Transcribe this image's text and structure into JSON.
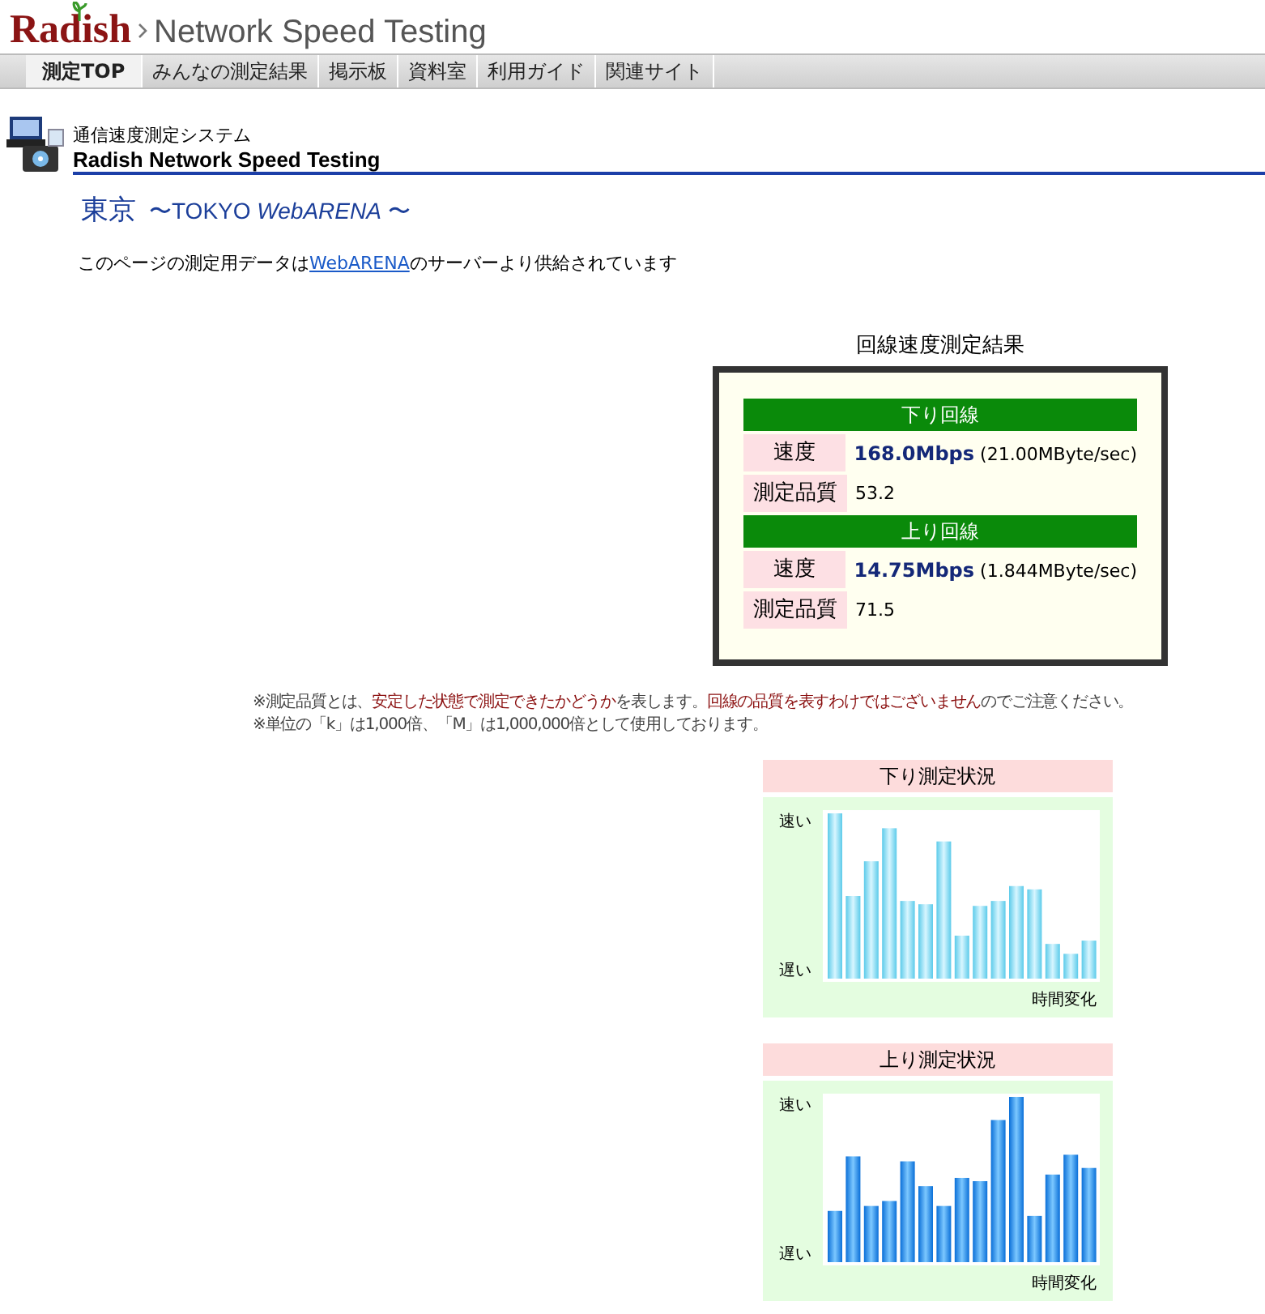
{
  "header": {
    "logo": "Radish",
    "title": "Network Speed Testing"
  },
  "nav": {
    "tabs": [
      {
        "label": "測定TOP",
        "selected": true
      },
      {
        "label": "みんなの測定結果",
        "selected": false
      },
      {
        "label": "掲示板",
        "selected": false
      },
      {
        "label": "資料室",
        "selected": false
      },
      {
        "label": "利用ガイド",
        "selected": false
      },
      {
        "label": "関連サイト",
        "selected": false
      }
    ]
  },
  "system": {
    "subtitle": "通信速度測定システム",
    "title": "Radish Network Speed Testing"
  },
  "location": {
    "city": "東京",
    "detail": "〜TOKYO *WebARENA* 〜"
  },
  "source_note": {
    "before": "このページの測定用データは",
    "link": "WebARENA",
    "after": "のサーバーより供給されています"
  },
  "results": {
    "title": "回線速度測定結果",
    "sections": [
      {
        "heading": "下り回線",
        "rows": [
          {
            "kind": "speed",
            "label": "速度",
            "value": "168.0Mbps",
            "detail": "(21.00MByte/sec)"
          },
          {
            "kind": "quality",
            "label": "測定品質",
            "value": "53.2"
          }
        ]
      },
      {
        "heading": "上り回線",
        "rows": [
          {
            "kind": "speed",
            "label": "速度",
            "value": "14.75Mbps",
            "detail": "(1.844MByte/sec)"
          },
          {
            "kind": "quality",
            "label": "測定品質",
            "value": "71.5"
          }
        ]
      }
    ]
  },
  "notes": [
    {
      "segments": [
        {
          "text": "※測定品質とは、",
          "emphasis": false
        },
        {
          "text": "安定した状態で測定できたかどうか",
          "emphasis": true
        },
        {
          "text": "を表します。",
          "emphasis": false
        },
        {
          "text": "回線の品質を表すわけではございません",
          "emphasis": true
        },
        {
          "text": "のでご注意ください。",
          "emphasis": false
        }
      ]
    },
    {
      "segments": [
        {
          "text": "※単位の「k」は1,000倍、「M」は1,000,000倍として使用しております。",
          "emphasis": false
        }
      ]
    }
  ],
  "status_charts": [
    {
      "kind": "download",
      "title": "下り測定状況",
      "fast_label": "速い",
      "slow_label": "遅い",
      "time_label": "時間変化"
    },
    {
      "kind": "upload",
      "title": "上り測定状況",
      "fast_label": "速い",
      "slow_label": "遅い",
      "time_label": "時間変化"
    }
  ]
}
